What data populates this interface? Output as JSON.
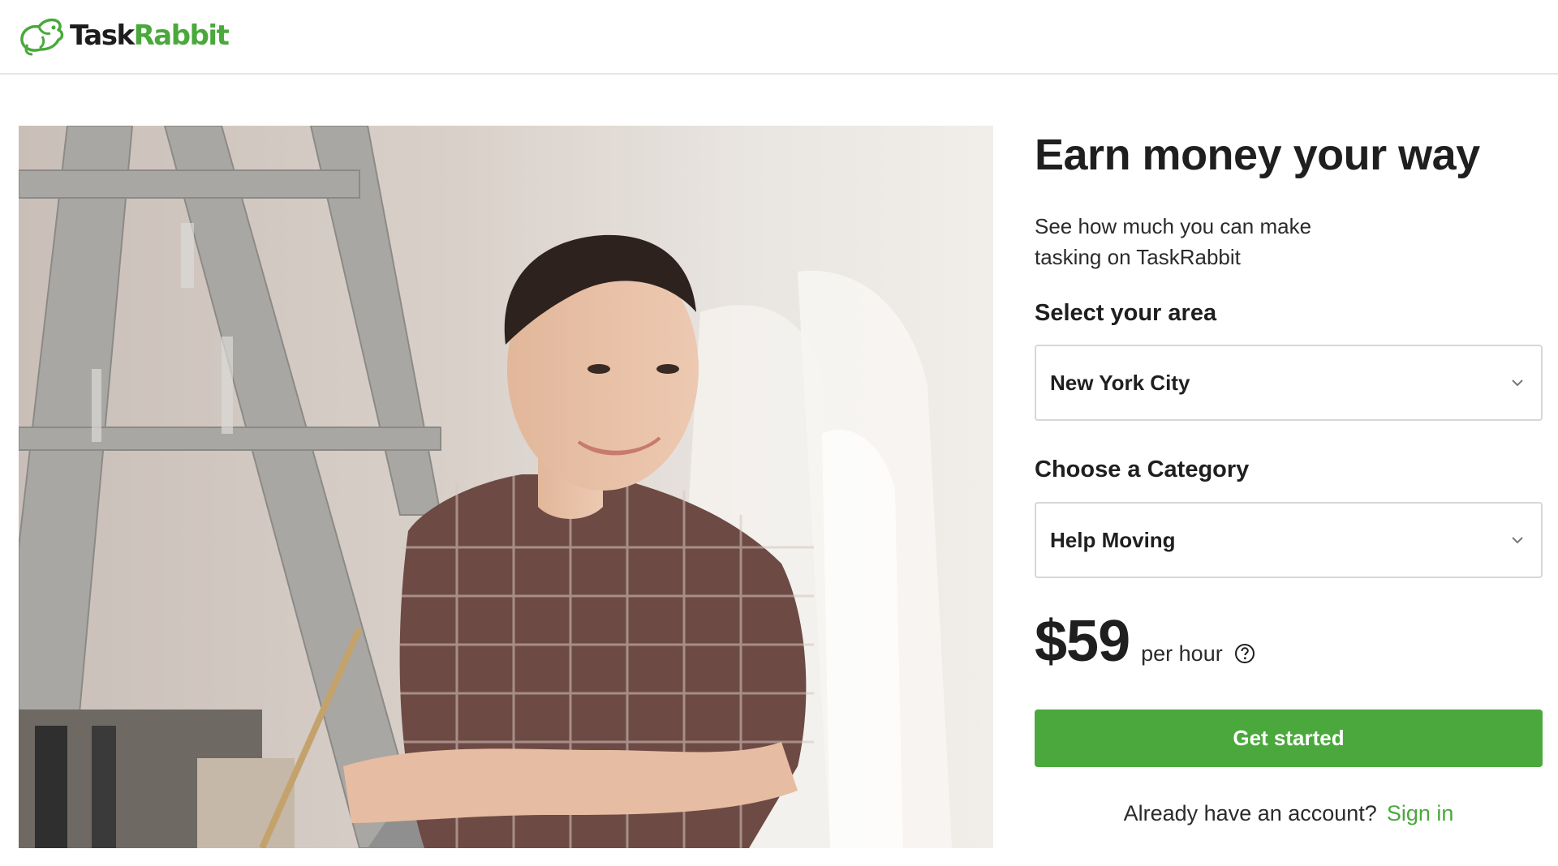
{
  "brand": {
    "name_part_1": "Task",
    "name_part_2": "Rabbit",
    "colors": {
      "accent": "#4aa83c",
      "text": "#1f1f1f",
      "border": "#d7d7d7"
    }
  },
  "hero": {
    "image": "photo-icon"
  },
  "panel": {
    "title": "Earn money your way",
    "subtitle": "See how much you can make tasking on TaskRabbit",
    "area_label": "Select your area",
    "area_value": "New York City",
    "category_label": "Choose a Category",
    "category_value": "Help Moving",
    "price": "$59",
    "price_unit": "per hour",
    "cta_label": "Get started",
    "account_prompt": "Already have an account?",
    "signin_label": "Sign in"
  },
  "icons": {
    "logo": "rabbit-logo-icon",
    "dropdown": "chevron-down-icon",
    "help": "question-circle-icon"
  }
}
